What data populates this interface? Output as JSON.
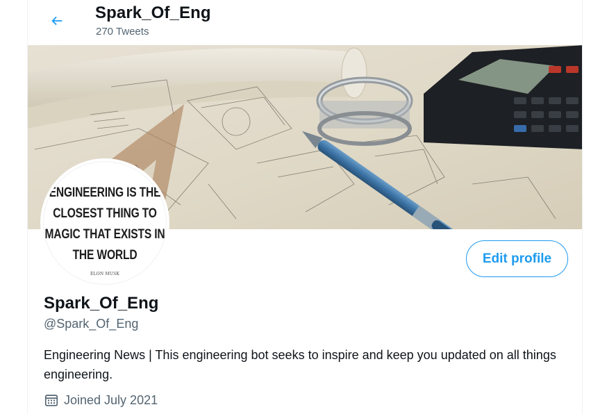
{
  "header": {
    "title": "Spark_Of_Eng",
    "tweet_count": "270 Tweets"
  },
  "avatar": {
    "quote": "ENGINEERING IS THE CLOSEST THING TO MAGIC THAT EXISTS IN THE WORLD",
    "author": "ELON MUSK"
  },
  "actions": {
    "edit_profile": "Edit profile"
  },
  "profile": {
    "name": "Spark_Of_Eng",
    "handle": "@Spark_Of_Eng",
    "bio": "Engineering News | This engineering bot seeks to inspire and keep you updated on all things engineering.",
    "joined": "Joined July 2021"
  },
  "colors": {
    "accent": "#1d9bf0",
    "text_primary": "#0f1419",
    "text_secondary": "#536471"
  },
  "icons": {
    "back": "arrow-left-icon",
    "calendar": "calendar-icon"
  }
}
